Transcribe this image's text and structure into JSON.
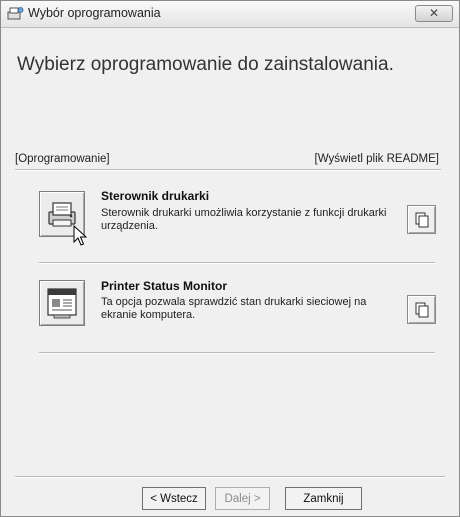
{
  "window": {
    "title": "Wybór oprogramowania",
    "close_glyph": "✕",
    "icons": {
      "title": "installer-icon",
      "close": "close-icon"
    }
  },
  "heading": "Wybierz oprogramowanie do zainstalowania.",
  "section": {
    "left_label": "[Oprogramowanie]",
    "right_label": "[Wyświetl plik README]"
  },
  "items": [
    {
      "title": "Sterownik drukarki",
      "description": "Sterownik drukarki umożliwia korzystanie z funkcji drukarki urządzenia.",
      "icon": "printer-icon",
      "readme_icon": "document-icon"
    },
    {
      "title": "Printer Status Monitor",
      "description": "Ta opcja pozwala sprawdzić stan drukarki sieciowej na ekranie komputera.",
      "icon": "status-monitor-icon",
      "readme_icon": "document-icon"
    }
  ],
  "buttons": {
    "back": "< Wstecz",
    "next": "Dalej >",
    "close": "Zamknij"
  }
}
